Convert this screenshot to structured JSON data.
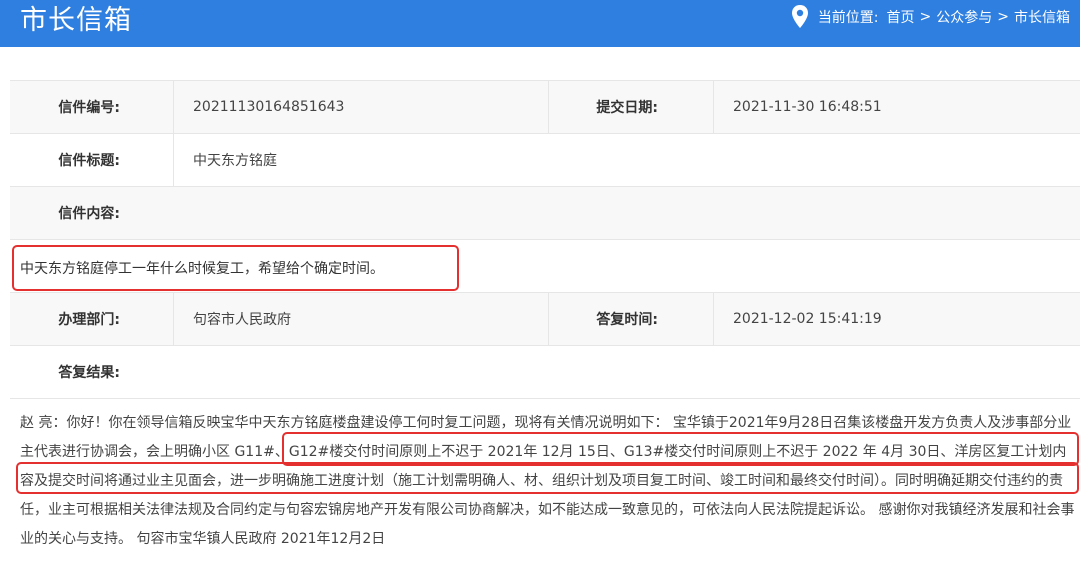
{
  "header": {
    "title": "市长信箱",
    "location_label": "当前位置:",
    "breadcrumb": [
      "首页",
      "公众参与",
      "市长信箱"
    ],
    "breadcrumb_sep": ">"
  },
  "letter": {
    "id_label": "信件编号:",
    "id_value": "20211130164851643",
    "date_label": "提交日期:",
    "date_value": "2021-11-30 16:48:51",
    "title_label": "信件标题:",
    "title_value": "中天东方铭庭",
    "content_label": "信件内容:",
    "content_value": "中天东方铭庭停工一年什么时候复工，希望给个确定时间。"
  },
  "reply": {
    "dept_label": "办理部门:",
    "dept_value": "句容市人民政府",
    "time_label": "答复时间:",
    "time_value": "2021-12-02 15:41:19",
    "result_label": "答复结果:",
    "result_text": "赵 亮：你好！你在领导信箱反映宝华中天东方铭庭楼盘建设停工何时复工问题，现将有关情况说明如下：  宝华镇于2021年9月28日召集该楼盘开发方负责人及涉事部分业主代表进行协调会，会上明确小区 G11#、G12#楼交付时间原则上不迟于 2021年 12月 15日、G13#楼交付时间原则上不迟于 2022 年 4月 30日、洋房区复工计划内容及提交时间将通过业主见面会，进一步明确施工进度计划（施工计划需明确人、材、组织计划及项目复工时间、竣工时间和最终交付时间）。同时明确延期交付违约的责任，业主可根据相关法律法规及合同约定与句容宏锦房地产开发有限公司协商解决，如不能达成一致意见的，可依法向人民法院提起诉讼。 感谢你对我镇经济发展和社会事业的关心与支持。    句容市宝华镇人民政府 2021年12月2日"
  },
  "colors": {
    "header_bg": "#2f7fe0",
    "highlight": "#e53030"
  },
  "icons": {
    "location": "map-pin-icon"
  }
}
